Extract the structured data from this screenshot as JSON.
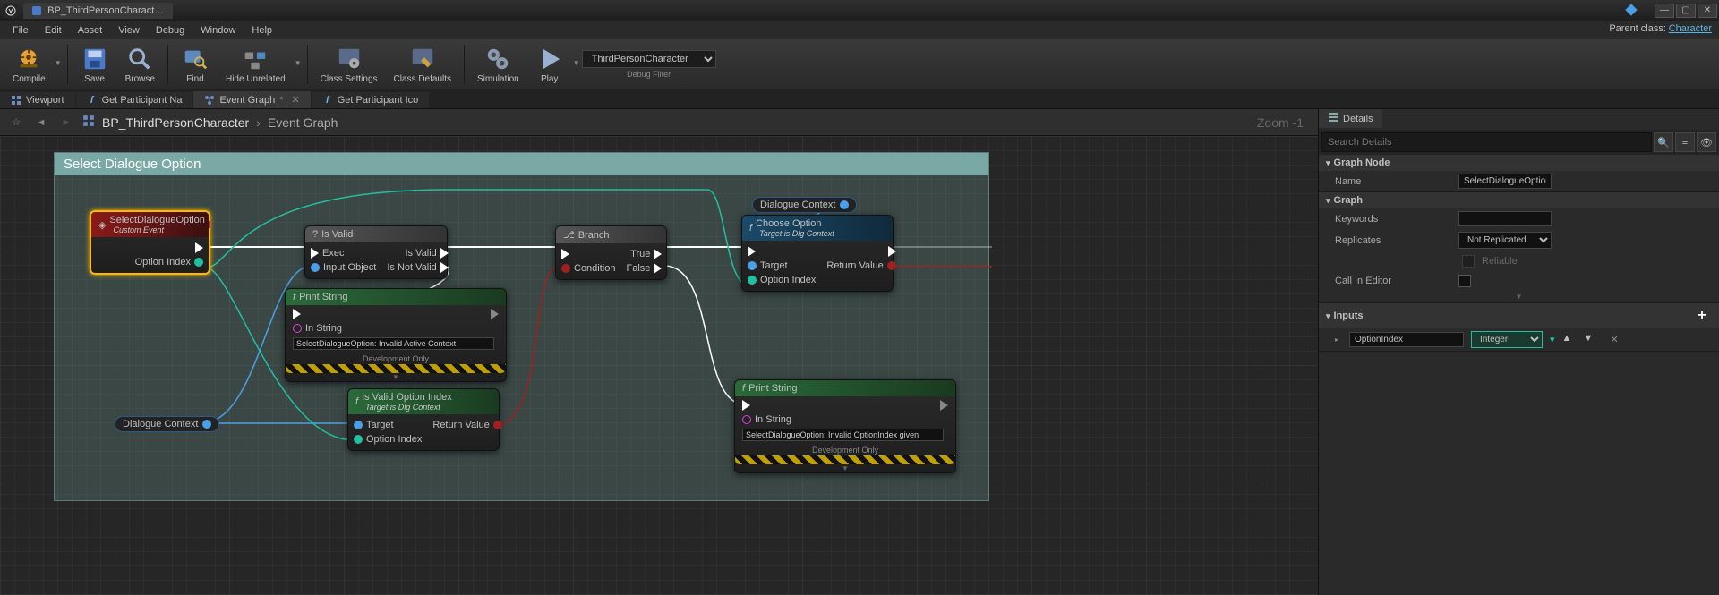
{
  "titlebar": {
    "tab_label": "BP_ThirdPersonCharact…"
  },
  "parent_class": {
    "label": "Parent class:",
    "value": "Character"
  },
  "menubar": [
    "File",
    "Edit",
    "Asset",
    "View",
    "Debug",
    "Window",
    "Help"
  ],
  "toolbar": {
    "compile": "Compile",
    "save": "Save",
    "browse": "Browse",
    "find": "Find",
    "hide_unrelated": "Hide Unrelated",
    "class_settings": "Class Settings",
    "class_defaults": "Class Defaults",
    "simulation": "Simulation",
    "play": "Play",
    "debug_filter": {
      "selected": "ThirdPersonCharacter",
      "label": "Debug Filter"
    }
  },
  "doc_tabs": [
    {
      "icon": "viewport",
      "label": "Viewport"
    },
    {
      "icon": "fn",
      "label": "Get Participant Na"
    },
    {
      "icon": "graph",
      "label": "Event Graph",
      "active": true,
      "modified": true
    },
    {
      "icon": "fn",
      "label": "Get Participant Ico"
    }
  ],
  "crumbs": {
    "bp": "BP_ThirdPersonCharacter",
    "graph": "Event Graph",
    "zoom": "Zoom -1"
  },
  "comment": {
    "title": "Select Dialogue Option"
  },
  "nodes": {
    "event": {
      "title": "SelectDialogueOption",
      "subtitle": "Custom Event",
      "pin_option_index": "Option Index"
    },
    "isvalid": {
      "title": "Is Valid",
      "exec_in": "Exec",
      "input_obj": "Input Object",
      "out_valid": "Is Valid",
      "out_notvalid": "Is Not Valid"
    },
    "printstr1": {
      "title": "Print String",
      "in_string": "In String",
      "value": "SelectDialogueOption: Invalid Active Context",
      "dev_only": "Development Only"
    },
    "isvalidopt": {
      "title": "Is Valid Option Index",
      "subtitle": "Target is Dlg Context",
      "target": "Target",
      "option_index": "Option Index",
      "return": "Return Value"
    },
    "branch": {
      "title": "Branch",
      "cond": "Condition",
      "out_true": "True",
      "out_false": "False"
    },
    "choose": {
      "title": "Choose Option",
      "subtitle": "Target is Dlg Context",
      "target": "Target",
      "option_index": "Option Index",
      "return": "Return Value"
    },
    "printstr2": {
      "title": "Print String",
      "in_string": "In String",
      "value": "SelectDialogueOption: Invalid OptionIndex given",
      "dev_only": "Development Only"
    },
    "dlgctx_var": "Dialogue Context",
    "dlgctx_top": "Dialogue Context"
  },
  "details": {
    "tab": "Details",
    "search_placeholder": "Search Details",
    "graph_node": {
      "head": "Graph Node",
      "name_k": "Name",
      "name_v": "SelectDialogueOption"
    },
    "graph": {
      "head": "Graph",
      "keywords_k": "Keywords",
      "keywords_v": "",
      "replicates_k": "Replicates",
      "replicates_v": "Not Replicated",
      "reliable": "Reliable",
      "call_editor_k": "Call In Editor"
    },
    "inputs": {
      "head": "Inputs",
      "param_name": "OptionIndex",
      "param_type": "Integer"
    }
  }
}
